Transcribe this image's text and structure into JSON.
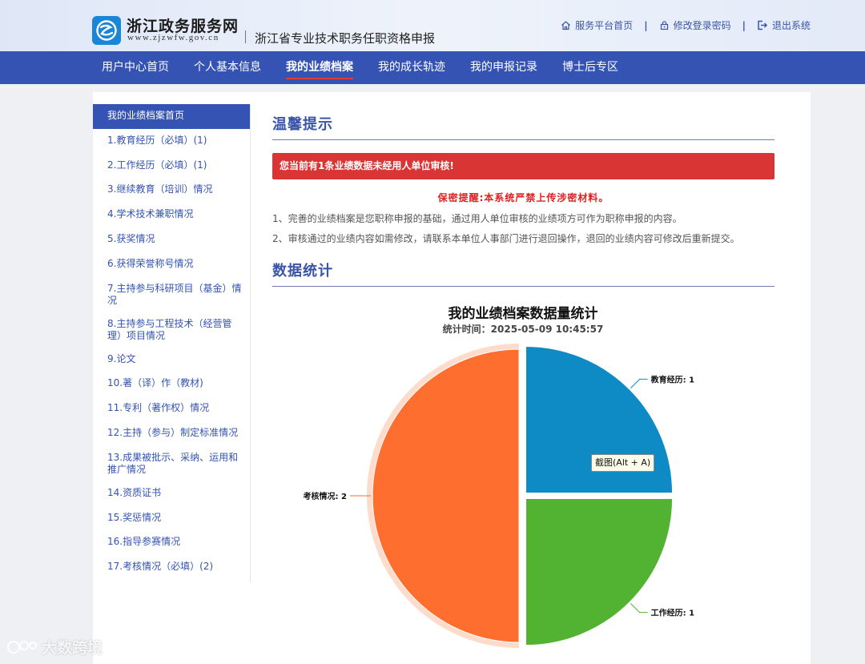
{
  "header": {
    "site_name": "浙江政务服务网",
    "site_url": "www.zjzwfw.gov.cn",
    "subtitle": "浙江省专业技术职务任职资格申报",
    "links": [
      {
        "label": "服务平台首页",
        "icon": "home-icon"
      },
      {
        "label": "修改登录密码",
        "icon": "lock-icon"
      },
      {
        "label": "退出系统",
        "icon": "logout-icon"
      }
    ],
    "separator": "|"
  },
  "nav": {
    "items": [
      {
        "label": "用户中心首页",
        "active": false
      },
      {
        "label": "个人基本信息",
        "active": false
      },
      {
        "label": "我的业绩档案",
        "active": true
      },
      {
        "label": "我的成长轨迹",
        "active": false
      },
      {
        "label": "我的申报记录",
        "active": false
      },
      {
        "label": "博士后专区",
        "active": false
      }
    ]
  },
  "sidebar": {
    "items": [
      {
        "label": "我的业绩档案首页",
        "active": true
      },
      {
        "label": "1.教育经历（必填）(1)"
      },
      {
        "label": "2.工作经历（必填）(1)"
      },
      {
        "label": "3.继续教育（培训）情况"
      },
      {
        "label": "4.学术技术兼职情况"
      },
      {
        "label": "5.获奖情况"
      },
      {
        "label": "6.获得荣誉称号情况"
      },
      {
        "label": "7.主持参与科研项目（基金）情况"
      },
      {
        "label": "8.主持参与工程技术（经营管理）项目情况"
      },
      {
        "label": "9.论文"
      },
      {
        "label": "10.著（译）作（教材)"
      },
      {
        "label": "11.专利（著作权）情况"
      },
      {
        "label": "12.主持（参与）制定标准情况"
      },
      {
        "label": "13.成果被批示、采纳、运用和推广情况"
      },
      {
        "label": "14.资质证书"
      },
      {
        "label": "15.奖惩情况"
      },
      {
        "label": "16.指导参赛情况"
      },
      {
        "label": "17.考核情况（必填）(2)"
      }
    ]
  },
  "main": {
    "tips_title": "温馨提示",
    "alert": "您当前有1条业绩数据未经用人单位审核!",
    "secret": "保密提醒:本系统严禁上传涉密材料。",
    "notes": [
      "1、完善的业绩档案是您职称申报的基础，通过用人单位审核的业绩项方可作为职称申报的内容。",
      "2、审核通过的业绩内容如需修改，请联系本单位人事部门进行退回操作，退回的业绩内容可修改后重新提交。"
    ],
    "stats_title": "数据统计"
  },
  "colors": {
    "nav_bg": "#3553b3",
    "alert_bg": "#d93535",
    "slice_edu": "#0e8ac5",
    "slice_work": "#52b232",
    "slice_assess": "#fd6e2f"
  },
  "chart_data": {
    "type": "pie",
    "title": "我的业绩档案数据量统计",
    "subtitle": "统计时间：2025-05-09 10:45:57",
    "slices": [
      {
        "name": "教育经历",
        "value": 1,
        "color": "#0e8ac5"
      },
      {
        "name": "工作经历",
        "value": 1,
        "color": "#52b232"
      },
      {
        "name": "考核情况",
        "value": 2,
        "color": "#fd6e2f"
      }
    ],
    "label_separator": ": ",
    "highlighted": "考核情况",
    "tooltip": "截图(Alt + A)"
  },
  "watermark": "大数跨境"
}
